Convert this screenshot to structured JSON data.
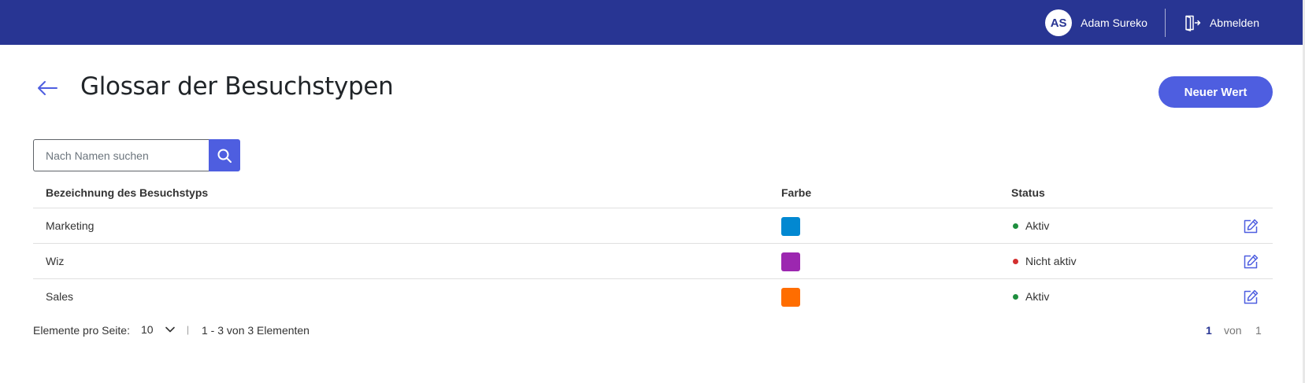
{
  "header": {
    "avatar_initials": "AS",
    "user_name": "Adam Sureko",
    "logout_label": "Abmelden"
  },
  "page": {
    "title": "Glossar der Besuchstypen",
    "new_button_label": "Neuer Wert"
  },
  "search": {
    "placeholder": "Nach Namen suchen",
    "value": ""
  },
  "table": {
    "columns": {
      "name": "Bezeichnung des Besuchstyps",
      "color": "Farbe",
      "status": "Status"
    },
    "rows": [
      {
        "name": "Marketing",
        "color": "#0288d1",
        "status": "Aktiv",
        "status_color": "#1e8e3e"
      },
      {
        "name": "Wiz",
        "color": "#9c27b0",
        "status": "Nicht aktiv",
        "status_color": "#d32f2f"
      },
      {
        "name": "Sales",
        "color": "#ff6d00",
        "status": "Aktiv",
        "status_color": "#1e8e3e"
      }
    ]
  },
  "pagination": {
    "per_page_label": "Elemente pro Seite:",
    "per_page_value": "10",
    "separator": "|",
    "range_label": "1 - 3 von 3 Elementen",
    "current_page": "1",
    "of_label": "von",
    "total_pages": "1"
  },
  "colors": {
    "topbar": "#283593",
    "accent": "#4e5ee0"
  },
  "icons": {
    "back": "arrow-left-icon",
    "logout": "logout-door-icon",
    "search": "search-icon",
    "edit": "edit-icon",
    "dropdown": "chevron-down-icon"
  }
}
